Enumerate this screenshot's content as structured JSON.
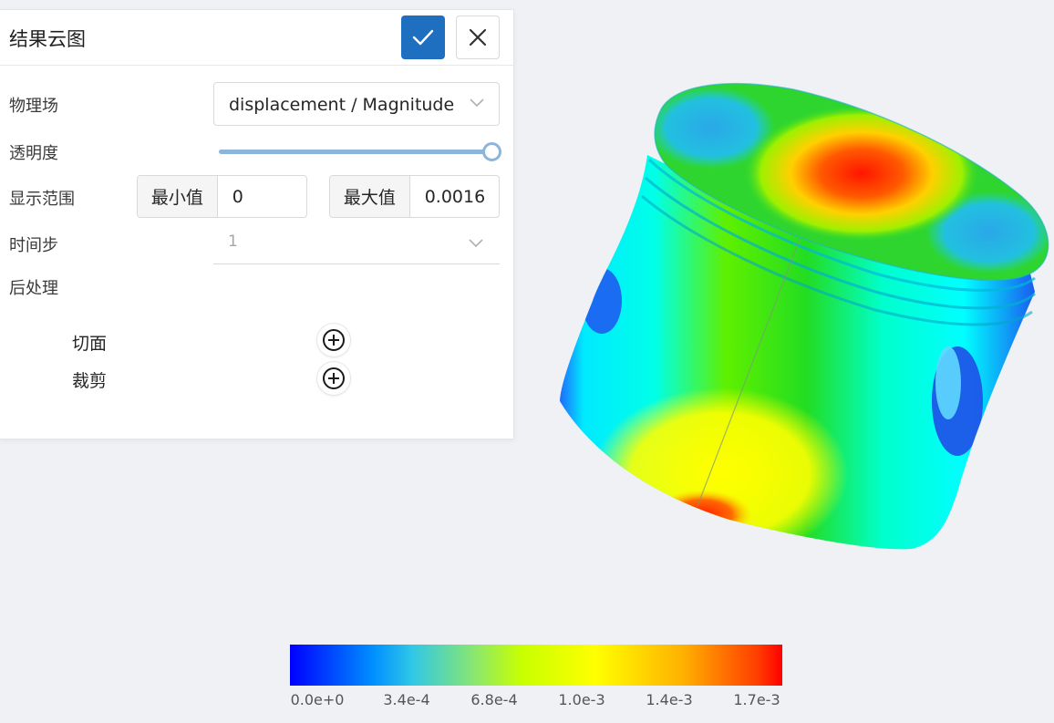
{
  "panel": {
    "title": "结果云图",
    "confirm_icon": "check-icon",
    "close_icon": "close-icon",
    "field_label": "物理场",
    "field_value": "displacement / Magnitude",
    "opacity_label": "透明度",
    "opacity_value": 1.0,
    "range_label": "显示范围",
    "min_label": "最小值",
    "min_value": "0",
    "max_label": "最大值",
    "max_value": "0.0016",
    "timestep_label": "时间步",
    "timestep_value": "1",
    "postprocess_label": "后处理",
    "slice_label": "切面",
    "clip_label": "裁剪",
    "accent_color": "#1e6fc0"
  },
  "legend": {
    "labels": [
      "0.0e+0",
      "3.4e-4",
      "6.8e-4",
      "1.0e-3",
      "1.4e-3",
      "1.7e-3"
    ],
    "colormap": [
      "#0000ff",
      "#00ffff",
      "#00ff00",
      "#ffff00",
      "#ff0000"
    ]
  }
}
